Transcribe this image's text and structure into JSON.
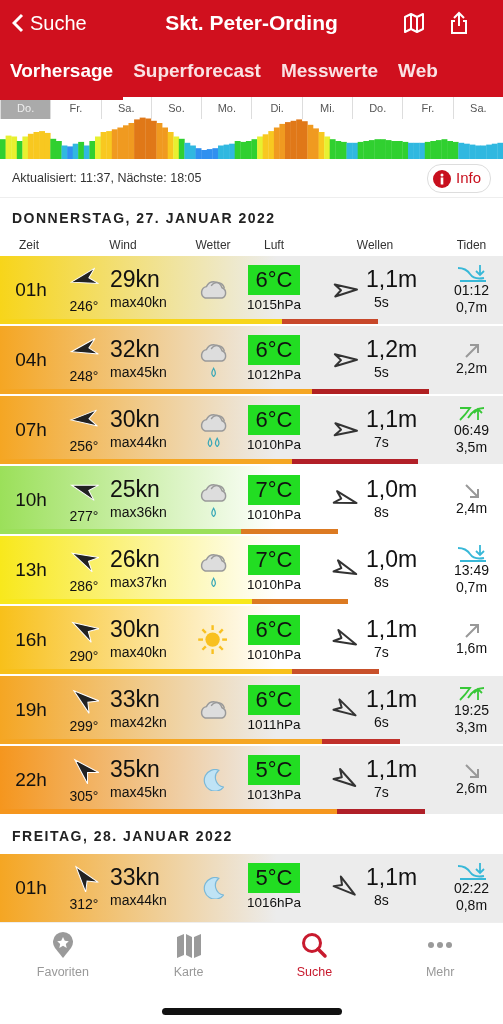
{
  "header": {
    "back": "Suche",
    "title": "Skt. Peter-Ording"
  },
  "tabs": [
    {
      "label": "Vorhersage",
      "selected": true
    },
    {
      "label": "Superforecast",
      "selected": false
    },
    {
      "label": "Messwerte",
      "selected": false
    },
    {
      "label": "Web",
      "selected": false
    }
  ],
  "overview_days": [
    {
      "label": "Do.",
      "selected": true
    },
    {
      "label": "Fr.",
      "selected": false
    },
    {
      "label": "Sa.",
      "selected": false
    },
    {
      "label": "So.",
      "selected": false
    },
    {
      "label": "Mo.",
      "selected": false
    },
    {
      "label": "Di.",
      "selected": false
    },
    {
      "label": "Mi.",
      "selected": false
    },
    {
      "label": "Do.",
      "selected": false
    },
    {
      "label": "Fr.",
      "selected": false
    },
    {
      "label": "Sa.",
      "selected": false
    }
  ],
  "update_text": "Aktualisiert: 11:37, Nächste: 18:05",
  "info_button": "Info",
  "days": [
    {
      "title": "DONNERSTAG, 27. JANUAR 2022",
      "columns": [
        "Zeit",
        "Wind",
        "Wetter",
        "Luft",
        "Wellen",
        "Tiden"
      ],
      "rows": [
        {
          "time": "01h",
          "color": "#f7d51a",
          "daylight": false,
          "direction": "246°",
          "speed": "29kn",
          "gust": "max40kn",
          "weather": {
            "kind": "cloud"
          },
          "temp": "6°C",
          "pressure": "1015hPa",
          "wave": "1,1m",
          "period": "5s",
          "tide": {
            "kind": "low",
            "time": "01:12",
            "height": "0,7m"
          },
          "wind_bar": {
            "level": 0.56
          },
          "wave_bar": {
            "color": "#c8482a"
          }
        },
        {
          "time": "04h",
          "color": "#f5a623",
          "daylight": false,
          "direction": "248°",
          "speed": "32kn",
          "gust": "max45kn",
          "weather": {
            "kind": "light_rain"
          },
          "temp": "6°C",
          "pressure": "1012hPa",
          "wave": "1,2m",
          "period": "5s",
          "tide": {
            "kind": "rising",
            "height": "2,2m"
          },
          "wind_bar": {
            "level": 0.62
          },
          "wave_bar": {
            "color": "#b02022"
          }
        },
        {
          "time": "07h",
          "color": "#f5a623",
          "daylight": false,
          "direction": "256°",
          "speed": "30kn",
          "gust": "max44kn",
          "weather": {
            "kind": "rain"
          },
          "temp": "6°C",
          "pressure": "1010hPa",
          "wave": "1,1m",
          "period": "7s",
          "tide": {
            "kind": "high",
            "time": "06:49",
            "height": "3,5m"
          },
          "wind_bar": {
            "level": 0.58
          },
          "wave_bar": {
            "color": "#b22028"
          }
        },
        {
          "time": "10h",
          "color": "#9be05a",
          "daylight": true,
          "direction": "277°",
          "speed": "25kn",
          "gust": "max36kn",
          "weather": {
            "kind": "light_rain"
          },
          "temp": "7°C",
          "pressure": "1010hPa",
          "wave": "1,0m",
          "period": "8s",
          "tide": {
            "kind": "falling",
            "height": "2,4m"
          },
          "wind_bar": {
            "level": 0.48
          },
          "wave_bar": {
            "color": "#dc7a22"
          }
        },
        {
          "time": "13h",
          "color": "#f8e81c",
          "daylight": true,
          "direction": "286°",
          "speed": "26kn",
          "gust": "max37kn",
          "weather": {
            "kind": "light_rain"
          },
          "temp": "7°C",
          "pressure": "1010hPa",
          "wave": "1,0m",
          "period": "8s",
          "tide": {
            "kind": "low",
            "time": "13:49",
            "height": "0,7m"
          },
          "wind_bar": {
            "level": 0.5
          },
          "wave_bar": {
            "color": "#dc7a22"
          }
        },
        {
          "time": "16h",
          "color": "#f8c01a",
          "daylight": true,
          "direction": "290°",
          "speed": "30kn",
          "gust": "max40kn",
          "weather": {
            "kind": "sun"
          },
          "temp": "6°C",
          "pressure": "1010hPa",
          "wave": "1,1m",
          "period": "7s",
          "tide": {
            "kind": "rising",
            "height": "1,6m"
          },
          "wind_bar": {
            "level": 0.58
          },
          "wave_bar": {
            "color": "#c8502a"
          }
        },
        {
          "time": "19h",
          "color": "#f5a623",
          "daylight": false,
          "direction": "299°",
          "speed": "33kn",
          "gust": "max42kn",
          "weather": {
            "kind": "cloud"
          },
          "temp": "6°C",
          "pressure": "1011hPa",
          "wave": "1,1m",
          "period": "6s",
          "tide": {
            "kind": "high",
            "time": "19:25",
            "height": "3,3m"
          },
          "wind_bar": {
            "level": 0.64
          },
          "wave_bar": {
            "color": "#c0302a"
          }
        },
        {
          "time": "22h",
          "color": "#f5961e",
          "daylight": false,
          "direction": "305°",
          "speed": "35kn",
          "gust": "max45kn",
          "weather": {
            "kind": "moon"
          },
          "temp": "5°C",
          "pressure": "1013hPa",
          "wave": "1,1m",
          "period": "7s",
          "tide": {
            "kind": "falling",
            "height": "2,6m"
          },
          "wind_bar": {
            "level": 0.67
          },
          "wave_bar": {
            "color": "#b02028"
          }
        }
      ]
    },
    {
      "title": "FREITAG, 28. JANUAR 2022",
      "rows": [
        {
          "time": "01h",
          "color": "#f5a623",
          "daylight": false,
          "direction": "312°",
          "speed": "33kn",
          "gust": "max44kn",
          "weather": {
            "kind": "moon"
          },
          "temp": "5°C",
          "pressure": "1016hPa",
          "wave": "1,1m",
          "period": "8s",
          "tide": {
            "kind": "low",
            "time": "02:22",
            "height": "0,8m"
          }
        }
      ]
    }
  ],
  "tabbar": [
    {
      "label": "Favoriten",
      "selected": false
    },
    {
      "label": "Karte",
      "selected": false
    },
    {
      "label": "Suche",
      "selected": true
    },
    {
      "label": "Mehr",
      "selected": false
    }
  ]
}
